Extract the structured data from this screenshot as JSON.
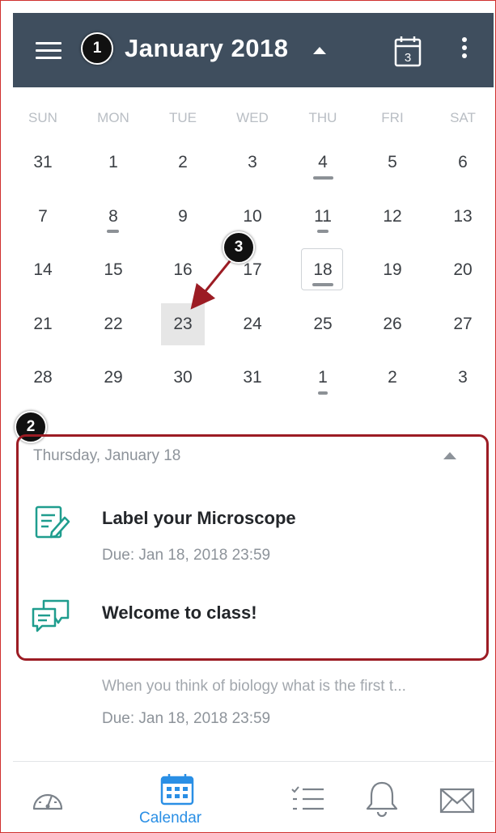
{
  "header": {
    "month_title": "January 2018",
    "calendar_icon_number": "3"
  },
  "callouts": [
    "1",
    "2",
    "3"
  ],
  "weekdays": [
    "SUN",
    "MON",
    "TUE",
    "WED",
    "THU",
    "FRI",
    "SAT"
  ],
  "weeks": [
    [
      "31",
      "1",
      "2",
      "3",
      "4",
      "5",
      "6"
    ],
    [
      "7",
      "8",
      "9",
      "10",
      "11",
      "12",
      "13"
    ],
    [
      "14",
      "15",
      "16",
      "17",
      "18",
      "19",
      "20"
    ],
    [
      "21",
      "22",
      "23",
      "24",
      "25",
      "26",
      "27"
    ],
    [
      "28",
      "29",
      "30",
      "31",
      "1",
      "2",
      "3"
    ]
  ],
  "selected_day": "23",
  "today_day": "18",
  "days_with_events": [
    "4",
    "8",
    "11",
    "18",
    "1"
  ],
  "events_panel": {
    "date_heading": "Thursday, January 18",
    "items": [
      {
        "icon": "assignment-icon",
        "title": "Label your Microscope",
        "due": "Due: Jan 18, 2018 23:59"
      },
      {
        "icon": "discussion-icon",
        "title": "Welcome to class!",
        "description": "When you think of biology what is the first t...",
        "due": "Due: Jan 18, 2018 23:59"
      }
    ]
  },
  "bottom_nav": {
    "items": [
      "dashboard-icon",
      "calendar-icon",
      "todo-icon",
      "notifications-icon",
      "inbox-icon"
    ],
    "active_label": "Calendar"
  },
  "colors": {
    "header_bg": "#3f4e5e",
    "accent_blue": "#2a8fe5",
    "teal_icon": "#1f9d8e",
    "callout_border": "#9c1c24"
  }
}
